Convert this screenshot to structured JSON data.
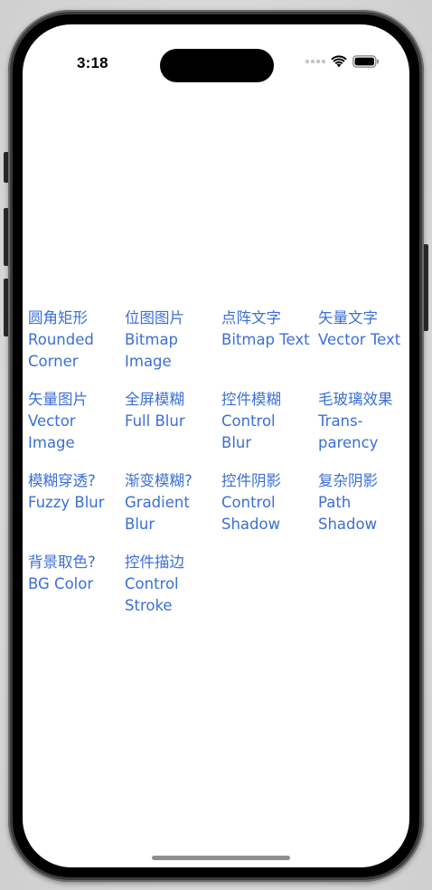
{
  "status_bar": {
    "time": "3:18"
  },
  "icons": {
    "wifi": "wifi-icon",
    "battery": "battery-icon",
    "cellular": "cellular-signal-icon"
  },
  "colors": {
    "link": "#3b6fd6",
    "background": "#ffffff"
  },
  "menu": {
    "items": [
      {
        "zh": "圆角矩形",
        "en": "Rounded\nCorner"
      },
      {
        "zh": "位图图片",
        "en": "Bitmap\nImage"
      },
      {
        "zh": "点阵文字",
        "en": "Bitmap Text"
      },
      {
        "zh": "矢量文字",
        "en": "Vector Text"
      },
      {
        "zh": "矢量图片",
        "en": "Vector\nImage"
      },
      {
        "zh": "全屏模糊",
        "en": "Full Blur"
      },
      {
        "zh": "控件模糊",
        "en": "Control\nBlur"
      },
      {
        "zh": "毛玻璃效果",
        "en": "Trans-\nparency"
      },
      {
        "zh": "模糊穿透?",
        "en": "Fuzzy Blur"
      },
      {
        "zh": "渐变模糊?",
        "en": "Gradient\nBlur"
      },
      {
        "zh": "控件阴影",
        "en": "Control\nShadow"
      },
      {
        "zh": "复杂阴影",
        "en": "Path\nShadow"
      },
      {
        "zh": "背景取色?",
        "en": "BG Color"
      },
      {
        "zh": "控件描边",
        "en": "Control\nStroke"
      }
    ]
  }
}
